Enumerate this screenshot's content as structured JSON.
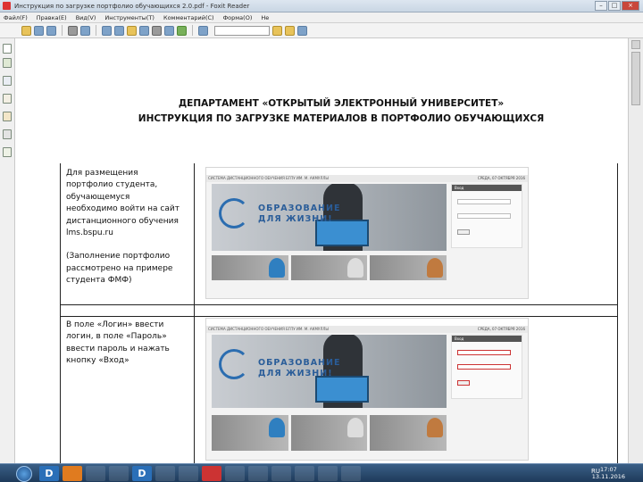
{
  "window": {
    "title": "Инструкция по загрузке портфолио обучающихся 2.0.pdf - Foxit Reader"
  },
  "menu": [
    "Файл(F)",
    "Правка(E)",
    "Вид(V)",
    "Инструменты(T)",
    "Комментарий(C)",
    "Форма(O)",
    "Не"
  ],
  "document": {
    "title_line1": "ДЕПАРТАМЕНТ «ОТКРЫТЫЙ ЭЛЕКТРОННЫЙ УНИВЕРСИТЕТ»",
    "title_line2": "ИНСТРУКЦИЯ ПО ЗАГРУЗКЕ МАТЕРИАЛОВ В ПОРТФОЛИО ОБУЧАЮЩИХСЯ",
    "rows": [
      {
        "lines": [
          "Для размещения",
          "портфолио студента,",
          "обучающемуся",
          "необходимо войти на сайт",
          "дистанционного обучения",
          "lms.bspu.ru",
          "",
          "(Заполнение портфолио",
          "рассмотрено на примере",
          "студента ФМФ)"
        ]
      },
      {
        "lines": [
          "В поле «Логин» ввести",
          "логин, в поле «Пароль»",
          "ввести пароль и нажать",
          "кнопку «Вход»"
        ]
      }
    ],
    "screenshot": {
      "site_bar": "СИСТЕМА ДИСТАНЦИОННОГО ОБУЧЕНИЯ БГПУ ИМ. М. АКМУЛЛЫ",
      "date_label": "СРЕДА, 07 ОКТЯБРЯ 2016",
      "slogan_line1": "ОБРАЗОВАНИЕ",
      "slogan_line2": "ДЛЯ ЖИЗНИ!",
      "login_header": "Вход"
    }
  },
  "taskbar": {
    "tasks": [
      "D",
      "D"
    ],
    "lang": "RU",
    "time": "17:07",
    "date": "13.11.2016"
  }
}
